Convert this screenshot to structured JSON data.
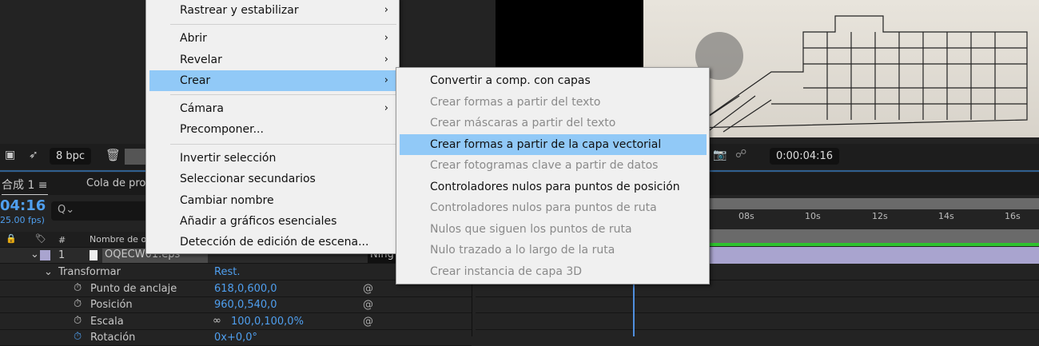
{
  "toolbar": {
    "bpc": "8 bpc",
    "timecode": "0:00:04:16"
  },
  "tabs": {
    "comp": "合成 1",
    "render": "Cola de proc"
  },
  "timeline": {
    "time": "04:16",
    "fps": "25.00 fps)",
    "search_placeholder": "Q⌄",
    "ticks": [
      "08s",
      "10s",
      "12s",
      "14s",
      "16s"
    ],
    "col_num": "#",
    "col_name": "Nombre de ori",
    "layer": {
      "index": "1",
      "name": "OQECW01.eps",
      "mode": "Ning"
    },
    "transform": {
      "label": "Transformar",
      "reset": "Rest."
    },
    "props": [
      {
        "name": "Punto de anclaje",
        "value": "618,0,600,0"
      },
      {
        "name": "Posición",
        "value": "960,0,540,0"
      },
      {
        "name": "Escala",
        "value": "100,0,100,0%"
      },
      {
        "name": "Rotación",
        "value": "0x+0,0°"
      }
    ]
  },
  "menu": {
    "items": [
      {
        "label": "Rastrear y estabilizar",
        "submenu": true
      },
      {
        "label": "Abrir",
        "submenu": true
      },
      {
        "label": "Revelar",
        "submenu": true
      },
      {
        "label": "Crear",
        "submenu": true,
        "highlighted": true
      },
      {
        "label": "Cámara",
        "submenu": true
      },
      {
        "label": "Precomponer..."
      },
      {
        "label": "Invertir selección"
      },
      {
        "label": "Seleccionar secundarios"
      },
      {
        "label": "Cambiar nombre"
      },
      {
        "label": "Añadir a gráficos esenciales"
      },
      {
        "label": "Detección de edición de escena..."
      }
    ]
  },
  "submenu": {
    "items": [
      {
        "label": "Convertir a comp. con capas",
        "enabled": true
      },
      {
        "label": "Crear formas a partir del texto",
        "enabled": false
      },
      {
        "label": "Crear máscaras a partir del texto",
        "enabled": false
      },
      {
        "label": "Crear formas a partir de la capa vectorial",
        "enabled": true,
        "highlighted": true
      },
      {
        "label": "Crear fotogramas clave a partir de datos",
        "enabled": false
      },
      {
        "label": "Controladores nulos para puntos de posición",
        "enabled": true
      },
      {
        "label": "Controladores nulos para puntos de ruta",
        "enabled": false
      },
      {
        "label": "Nulos que siguen los puntos de ruta",
        "enabled": false
      },
      {
        "label": "Nulo trazado a lo largo de la ruta",
        "enabled": false
      },
      {
        "label": "Crear instancia de capa 3D",
        "enabled": false
      }
    ]
  },
  "colors": {
    "highlight": "#91c9f7",
    "accent": "#4f9fef",
    "layer": "#a9a4cf",
    "green": "#2ec22e"
  }
}
